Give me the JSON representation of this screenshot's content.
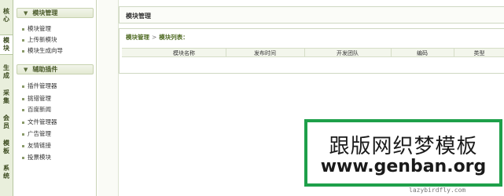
{
  "vertical_tabs": [
    {
      "chars": [
        "核",
        "心"
      ]
    },
    {
      "chars": [
        "模",
        "块"
      ]
    },
    {
      "chars": [
        "生",
        "成"
      ]
    },
    {
      "chars": [
        "采",
        "集"
      ]
    },
    {
      "chars": [
        "会",
        "员"
      ]
    },
    {
      "chars": [
        "模",
        "板"
      ]
    },
    {
      "chars": [
        "系",
        "统"
      ]
    }
  ],
  "sidebar": {
    "group1": {
      "label": "模块管理",
      "items": [
        "模块管理",
        "上传新模块",
        "模块生成向导"
      ]
    },
    "group2": {
      "label": "辅助插件",
      "items": [
        "插件管理器",
        "挑错管理",
        "百度新闻",
        "文件管理器",
        "广告管理",
        "友情链接",
        "投票模块"
      ]
    }
  },
  "main": {
    "title": "模块管理",
    "breadcrumb": {
      "root": "模块管理",
      "separator": ">",
      "current": "模块列表："
    },
    "columns": [
      "模块名称",
      "发布时间",
      "开发团队",
      "编码",
      "类型"
    ]
  },
  "watermark": {
    "line1": "跟版网织梦模板",
    "line2": "www.genban.org",
    "border_color": "#1ea04a"
  },
  "credit": "lazybirdfly.com"
}
